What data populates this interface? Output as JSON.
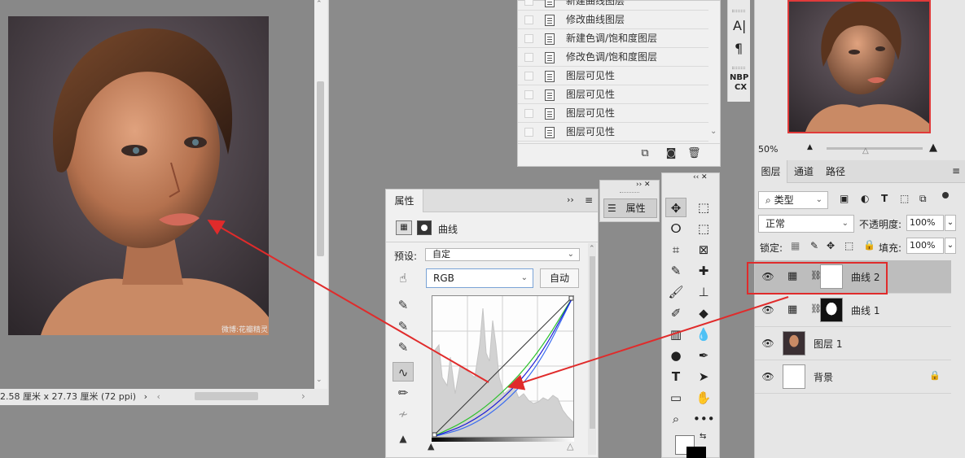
{
  "document": {
    "status": "2.58 厘米 x 27.73 厘米 (72 ppi)",
    "status_arrow": "›",
    "watermark": "微博:花瓣精灵"
  },
  "history": {
    "items": [
      {
        "label": "新建曲线图层"
      },
      {
        "label": "修改曲线图层"
      },
      {
        "label": "新建色调/饱和度图层"
      },
      {
        "label": "修改色调/饱和度图层"
      },
      {
        "label": "图层可见性"
      },
      {
        "label": "图层可见性"
      },
      {
        "label": "图层可见性"
      },
      {
        "label": "图层可见性"
      }
    ]
  },
  "side_strip": {
    "char_tool": "A|",
    "para_tool": "¶",
    "nbp": "NBP",
    "cx": "CX"
  },
  "properties": {
    "tab": "属性",
    "type_label": "曲线",
    "preset_label": "预设:",
    "preset_value": "自定",
    "channel_value": "RGB",
    "auto_button": "自动",
    "curves": {
      "diagonal": [
        [
          0,
          0
        ],
        [
          255,
          255
        ]
      ],
      "rgb": [
        [
          0,
          0
        ],
        [
          64,
          22
        ],
        [
          128,
          68
        ],
        [
          192,
          140
        ],
        [
          255,
          255
        ]
      ],
      "green": [
        [
          0,
          0
        ],
        [
          64,
          30
        ],
        [
          128,
          80
        ],
        [
          192,
          152
        ],
        [
          255,
          255
        ]
      ],
      "blue": [
        [
          0,
          0
        ],
        [
          64,
          16
        ],
        [
          128,
          58
        ],
        [
          192,
          128
        ],
        [
          255,
          255
        ]
      ]
    }
  },
  "mini_props": {
    "label": "属性"
  },
  "layers_panel": {
    "zoom": "50%",
    "tabs": [
      "图层",
      "通道",
      "路径"
    ],
    "filter_kind": "类型",
    "blend_mode": "正常",
    "opacity_label": "不透明度:",
    "opacity_value": "100%",
    "lock_label": "锁定:",
    "fill_label": "填充:",
    "fill_value": "100%",
    "layers": [
      {
        "name": "曲线 2",
        "type": "curves",
        "selected": true
      },
      {
        "name": "曲线 1",
        "type": "curves",
        "selected": false
      },
      {
        "name": "图层 1",
        "type": "pixel",
        "selected": false
      },
      {
        "name": "背景",
        "type": "background",
        "selected": false,
        "locked": true
      }
    ]
  },
  "colors": {
    "accent_red": "#e02b2b",
    "selected_layer": "#bdbdbd",
    "rgb_curve": "#1b1bd6",
    "green_curve": "#2cc02c",
    "blue_curve": "#3a6cf0"
  }
}
